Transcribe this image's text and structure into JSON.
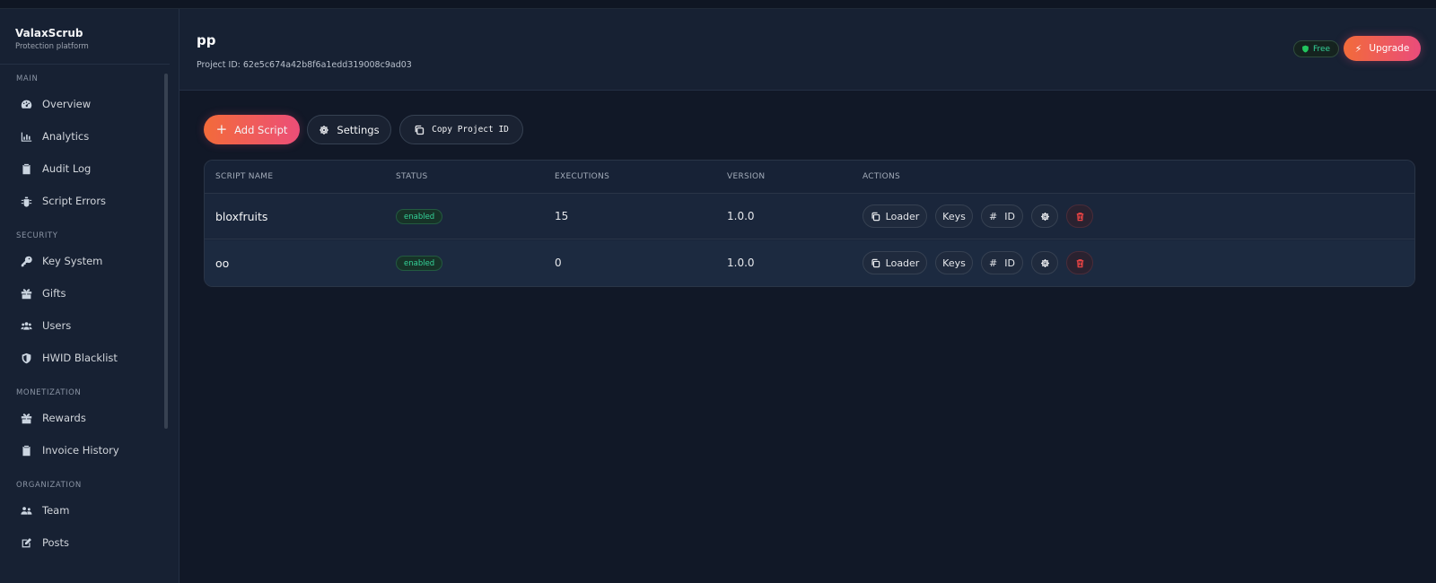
{
  "brand": {
    "name": "ValaxScrub",
    "subtitle": "Protection platform"
  },
  "sidebar": {
    "sections": [
      {
        "label": "MAIN",
        "items": [
          {
            "label": "Overview",
            "icon": "gauge-icon"
          },
          {
            "label": "Analytics",
            "icon": "chart-icon"
          },
          {
            "label": "Audit Log",
            "icon": "clipboard-icon"
          },
          {
            "label": "Script Errors",
            "icon": "bug-icon"
          }
        ]
      },
      {
        "label": "SECURITY",
        "items": [
          {
            "label": "Key System",
            "icon": "key-icon"
          },
          {
            "label": "Gifts",
            "icon": "gift-icon"
          },
          {
            "label": "Users",
            "icon": "users-icon"
          },
          {
            "label": "HWID Blacklist",
            "icon": "shield-icon"
          }
        ]
      },
      {
        "label": "MONETIZATION",
        "items": [
          {
            "label": "Rewards",
            "icon": "gift-icon"
          },
          {
            "label": "Invoice History",
            "icon": "clipboard-icon"
          }
        ]
      },
      {
        "label": "ORGANIZATION",
        "items": [
          {
            "label": "Team",
            "icon": "team-icon"
          },
          {
            "label": "Posts",
            "icon": "edit-icon"
          }
        ]
      }
    ]
  },
  "header": {
    "title": "pp",
    "project_id": "Project ID: 62e5c674a42b8f6a1edd319008c9ad03",
    "plan_badge": "Free",
    "upgrade_label": "Upgrade"
  },
  "toolbar": {
    "add_label": "Add Script",
    "settings_label": "Settings",
    "copy_label": "Copy Project ID"
  },
  "table": {
    "headers": [
      "SCRIPT NAME",
      "STATUS",
      "EXECUTIONS",
      "VERSION",
      "ACTIONS"
    ],
    "rows": [
      {
        "name": "bloxfruits",
        "status": "enabled",
        "executions": "15",
        "version": "1.0.0"
      },
      {
        "name": "oo",
        "status": "enabled",
        "executions": "0",
        "version": "1.0.0"
      }
    ],
    "actions": {
      "loader": "Loader",
      "keys": "Keys",
      "id": "ID"
    }
  },
  "colors": {
    "accent_start": "#f36b3a",
    "accent_end": "#ec4e78",
    "success": "#34d399",
    "danger": "#ef4444",
    "background": "#111827",
    "panel": "#172133"
  }
}
